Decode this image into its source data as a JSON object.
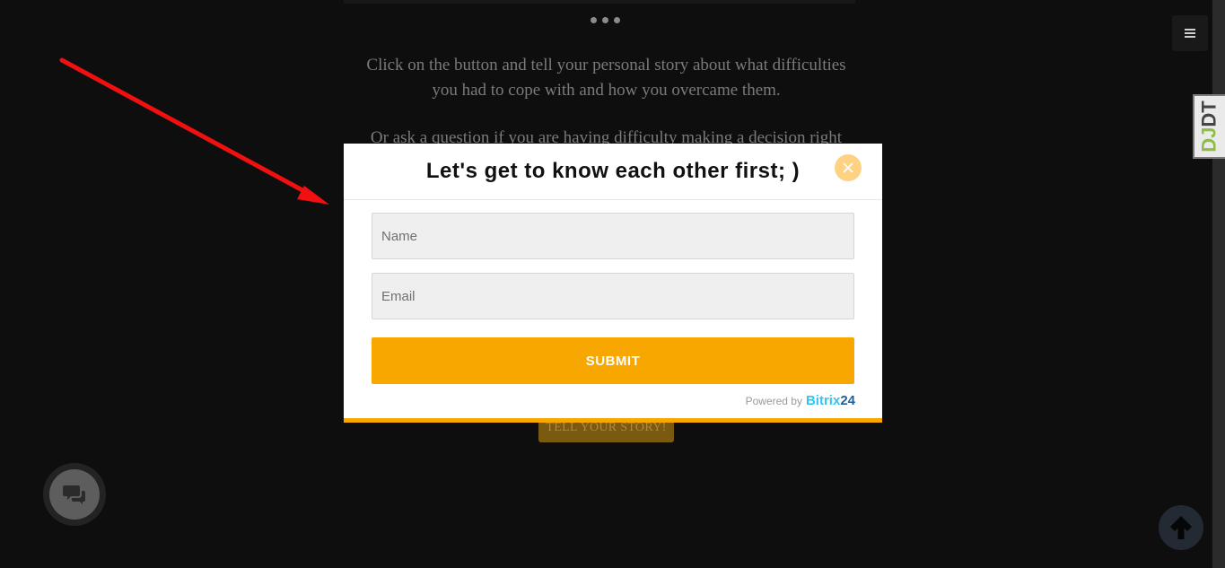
{
  "page": {
    "text_lines": [
      "Click on the button and tell your personal story about what difficulties",
      "you had to cope with and how you overcame them.",
      "Or ask a question if you are having difficulty making a decision right"
    ],
    "story_button": "TELL YOUR STORY!",
    "djdt_label_main": "DJ",
    "djdt_label_accent": "DT"
  },
  "icons": {
    "menu": "menu-icon",
    "chat": "chat-icon",
    "scroll_up": "arrow-up-icon",
    "close": "close-icon",
    "dots": "ellipsis-icon"
  },
  "modal": {
    "title": "Let's get to know each other first; )",
    "name_placeholder": "Name",
    "email_placeholder": "Email",
    "submit_label": "SUBMIT",
    "powered_prefix": "Powered by",
    "brand_part1": "Bitrix",
    "brand_part2": "24"
  },
  "colors": {
    "accent": "#f7a700",
    "background": "#0e0e0f",
    "close_bg": "#fdd383",
    "annotation_arrow": "#f01010"
  }
}
